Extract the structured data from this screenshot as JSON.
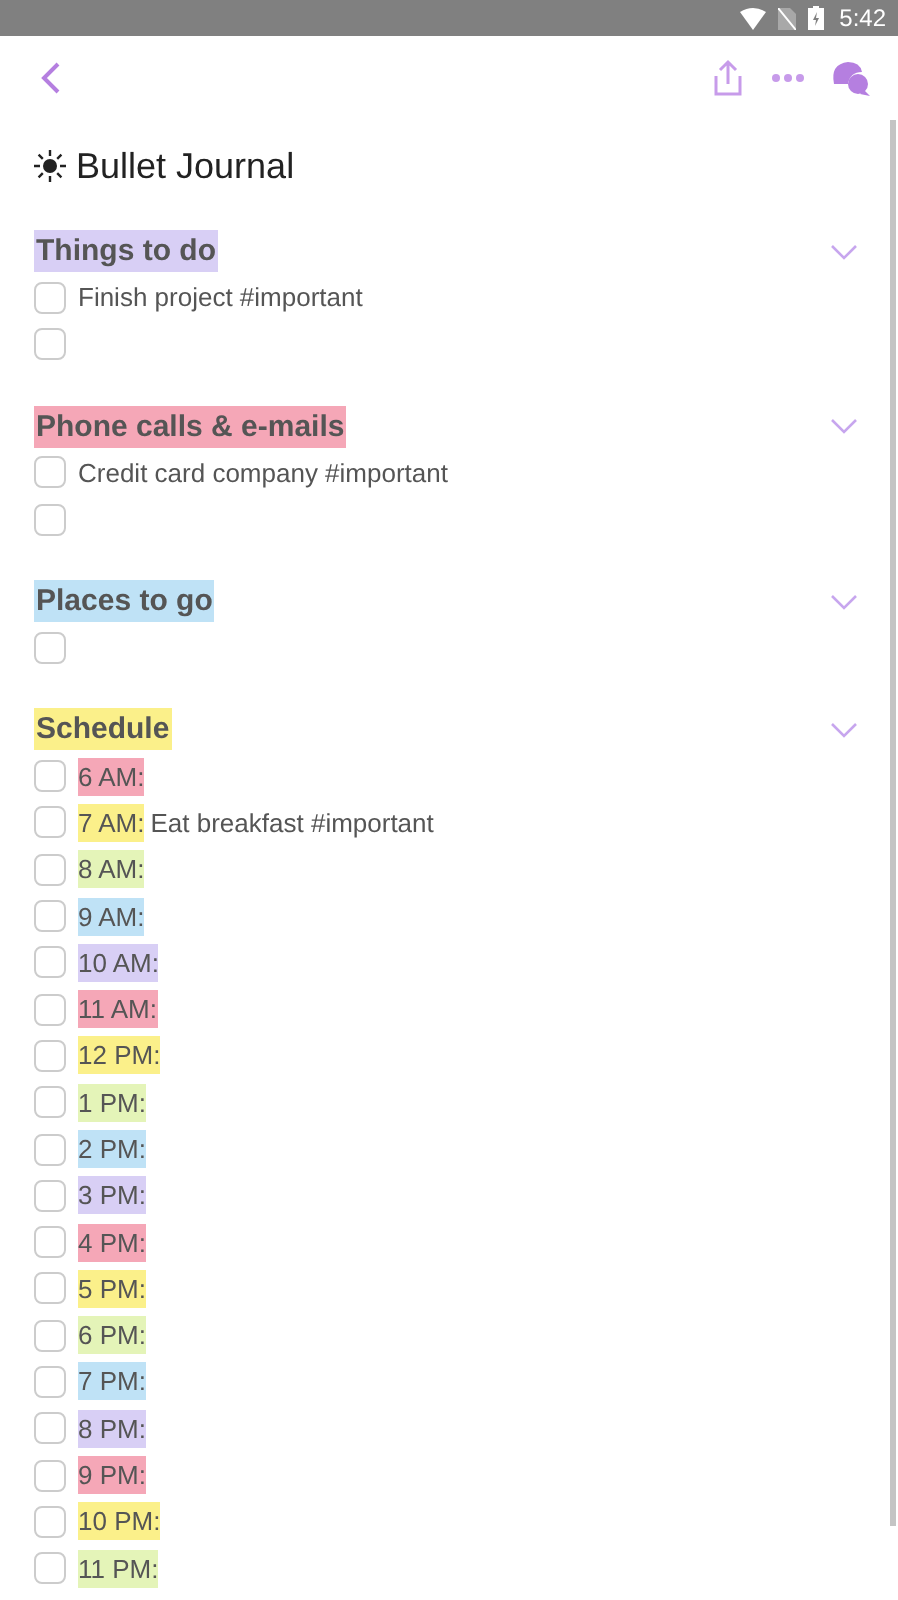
{
  "status_bar": {
    "time": "5:42"
  },
  "title": "Bullet Journal",
  "sections": [
    {
      "heading": "Things to do",
      "color": "#d8cff5",
      "items": [
        {
          "text": "Finish project #important",
          "checked": false
        },
        {
          "checked": false
        }
      ]
    },
    {
      "heading": "Phone calls & e-mails",
      "color": "#f5a7b7",
      "items": [
        {
          "text": "Credit card company #important",
          "checked": false
        },
        {
          "checked": false
        }
      ]
    },
    {
      "heading": "Places to go",
      "color": "#bfe2f6",
      "items": [
        {
          "checked": false
        }
      ]
    },
    {
      "heading": "Schedule",
      "color": "#fbf08a",
      "items": [
        {
          "time": "6 AM:",
          "color": "#f5a7b7",
          "checked": false
        },
        {
          "time": "7 AM:",
          "color": "#fbf08a",
          "text": "Eat breakfast #important",
          "checked": false
        },
        {
          "time": "8 AM:",
          "color": "#e4f4b8",
          "checked": false
        },
        {
          "time": "9 AM:",
          "color": "#bfe2f6",
          "checked": false
        },
        {
          "time": "10 AM:",
          "color": "#d8cff5",
          "checked": false
        },
        {
          "time": "11 AM:",
          "color": "#f5a7b7",
          "checked": false
        },
        {
          "time": "12 PM:",
          "color": "#fbf08a",
          "checked": false
        },
        {
          "time": "1 PM:",
          "color": "#e4f4b8",
          "checked": false
        },
        {
          "time": "2 PM:",
          "color": "#bfe2f6",
          "checked": false
        },
        {
          "time": "3 PM:",
          "color": "#d8cff5",
          "checked": false
        },
        {
          "time": "4 PM:",
          "color": "#f5a7b7",
          "checked": false
        },
        {
          "time": "5 PM:",
          "color": "#fbf08a",
          "checked": false
        },
        {
          "time": "6 PM:",
          "color": "#e4f4b8",
          "checked": false
        },
        {
          "time": "7 PM:",
          "color": "#bfe2f6",
          "checked": false
        },
        {
          "time": "8 PM:",
          "color": "#d8cff5",
          "checked": false
        },
        {
          "time": "9 PM:",
          "color": "#f5a7b7",
          "checked": false
        },
        {
          "time": "10 PM:",
          "color": "#fbf08a",
          "checked": false
        },
        {
          "time": "11 PM:",
          "color": "#e4f4b8",
          "checked": false
        }
      ]
    }
  ]
}
